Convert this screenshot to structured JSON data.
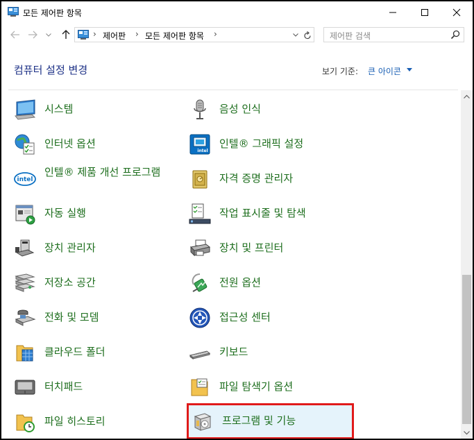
{
  "window": {
    "title": "모든 제어판 항목"
  },
  "address": {
    "crumbs": [
      "제어판",
      "모든 제어판 항목"
    ],
    "search_placeholder": "제어판 검색"
  },
  "header": {
    "title": "컴퓨터 설정 변경",
    "view_label": "보기 기준:",
    "view_value": "큰 아이콘"
  },
  "items_left": [
    {
      "label": "시스템",
      "icon": "system-icon"
    },
    {
      "label": "인터넷 옵션",
      "icon": "internet-options-icon"
    },
    {
      "label": "인텔® 제품 개선 프로그램",
      "icon": "intel-icon"
    },
    {
      "label": "자동 실행",
      "icon": "autoplay-icon"
    },
    {
      "label": "장치 관리자",
      "icon": "device-manager-icon"
    },
    {
      "label": "저장소 공간",
      "icon": "storage-spaces-icon"
    },
    {
      "label": "전화 및 모뎀",
      "icon": "phone-modem-icon"
    },
    {
      "label": "클라우드 폴더",
      "icon": "cloud-folder-icon"
    },
    {
      "label": "터치패드",
      "icon": "touchpad-icon"
    },
    {
      "label": "파일 히스토리",
      "icon": "file-history-icon"
    }
  ],
  "items_right": [
    {
      "label": "음성 인식",
      "icon": "microphone-icon"
    },
    {
      "label": "인텔® 그래픽 설정",
      "icon": "intel-graphics-icon"
    },
    {
      "label": "자격 증명 관리자",
      "icon": "credential-manager-icon"
    },
    {
      "label": "작업 표시줄 및 탐색",
      "icon": "taskbar-icon"
    },
    {
      "label": "장치 및 프린터",
      "icon": "printer-icon"
    },
    {
      "label": "전원 옵션",
      "icon": "power-options-icon"
    },
    {
      "label": "접근성 센터",
      "icon": "ease-of-access-icon"
    },
    {
      "label": "키보드",
      "icon": "keyboard-icon"
    },
    {
      "label": "파일 탐색기 옵션",
      "icon": "folder-options-icon"
    },
    {
      "label": "프로그램 및 기능",
      "icon": "programs-features-icon"
    }
  ],
  "colors": {
    "link_green": "#1d6e1d",
    "title_blue": "#1e3287",
    "highlight_border": "#e01a1a",
    "highlight_bg": "#e5f3fb"
  }
}
